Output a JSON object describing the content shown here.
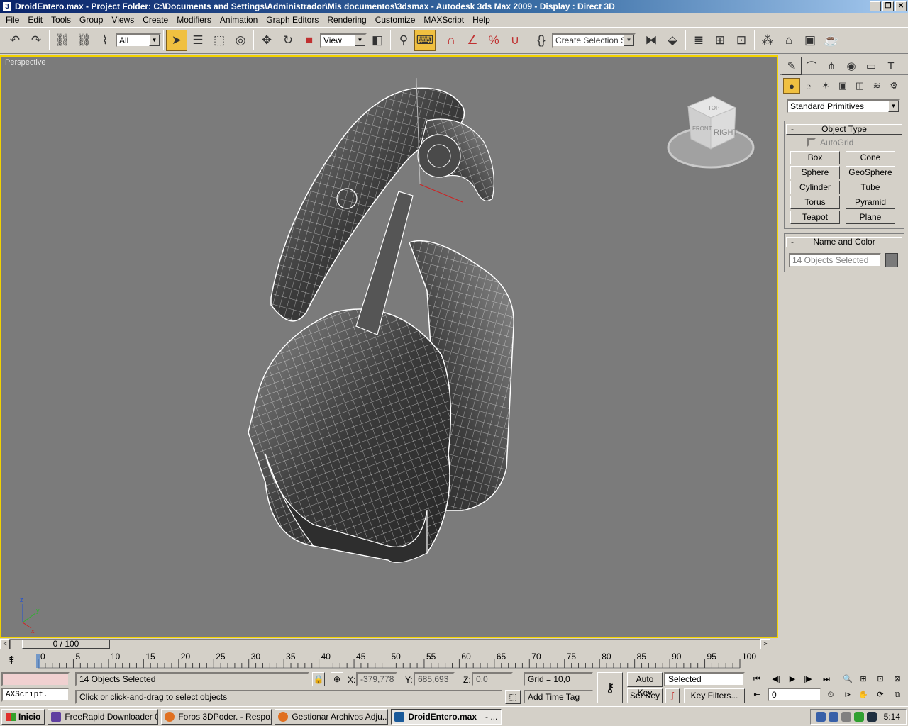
{
  "window": {
    "title": "DroidEntero.max    - Project Folder: C:\\Documents and Settings\\Administrador\\Mis documentos\\3dsmax    - Autodesk 3ds Max  2009      - Display : Direct 3D",
    "app_icon": "3ds-max-icon"
  },
  "menu": [
    "File",
    "Edit",
    "Tools",
    "Group",
    "Views",
    "Create",
    "Modifiers",
    "Animation",
    "Graph Editors",
    "Rendering",
    "Customize",
    "MAXScript",
    "Help"
  ],
  "toolbar": {
    "selection_filter": "All",
    "reference_coord": "View",
    "named_selection_placeholder": "Create Selection Set"
  },
  "viewport": {
    "label": "Perspective",
    "viewcube_faces": {
      "top": "TOP",
      "front": "FRONT",
      "right": "RIGHT"
    },
    "axis_labels": {
      "z": "z",
      "y": "y",
      "x": "x"
    },
    "background_color": "#7b7b7b",
    "active_border_color": "#f2d200"
  },
  "command_panel": {
    "category_dropdown": "Standard Primitives",
    "object_type": {
      "title": "Object Type",
      "collapse_symbol": "-",
      "autogrid_label": "AutoGrid",
      "buttons": [
        "Box",
        "Cone",
        "Sphere",
        "GeoSphere",
        "Cylinder",
        "Tube",
        "Torus",
        "Pyramid",
        "Teapot",
        "Plane"
      ]
    },
    "name_and_color": {
      "title": "Name and Color",
      "collapse_symbol": "-",
      "name_value": "14 Objects Selected",
      "swatch_color": "#7a7a7a"
    }
  },
  "time_slider": {
    "frame_readout": "0 / 100",
    "prev_symbol": "<",
    "next_symbol": ">"
  },
  "trackbar": {
    "tick_labels": [
      "0",
      "5",
      "10",
      "15",
      "20",
      "25",
      "30",
      "35",
      "40",
      "45",
      "50",
      "55",
      "60",
      "65",
      "70",
      "75",
      "80",
      "85",
      "90",
      "95",
      "100"
    ]
  },
  "status": {
    "maxscript_listener": "AXScript.",
    "selection_count": "14 Objects Selected",
    "prompt": "Click or click-and-drag to select objects",
    "x_label": "X:",
    "x_value": "-379,778",
    "y_label": "Y:",
    "y_value": "685,693",
    "z_label": "Z:",
    "z_value": "0,0",
    "grid": "Grid = 10,0",
    "add_time_tag": "Add Time Tag",
    "auto_key": "Auto Key",
    "set_key": "Set Key",
    "key_mode": "Selected",
    "key_filters": "Key Filters...",
    "current_frame": "0"
  },
  "taskbar": {
    "start": "Inicio",
    "tasks": [
      {
        "label": "FreeRapid Downloader 0...",
        "active": false
      },
      {
        "label": "Foros 3DPoder. - Respo...",
        "active": false
      },
      {
        "label": "Gestionar Archivos Adju...",
        "active": false
      },
      {
        "label": "DroidEntero.max",
        "active": true
      }
    ],
    "extra_dash": "- ...",
    "clock": "5:14"
  }
}
